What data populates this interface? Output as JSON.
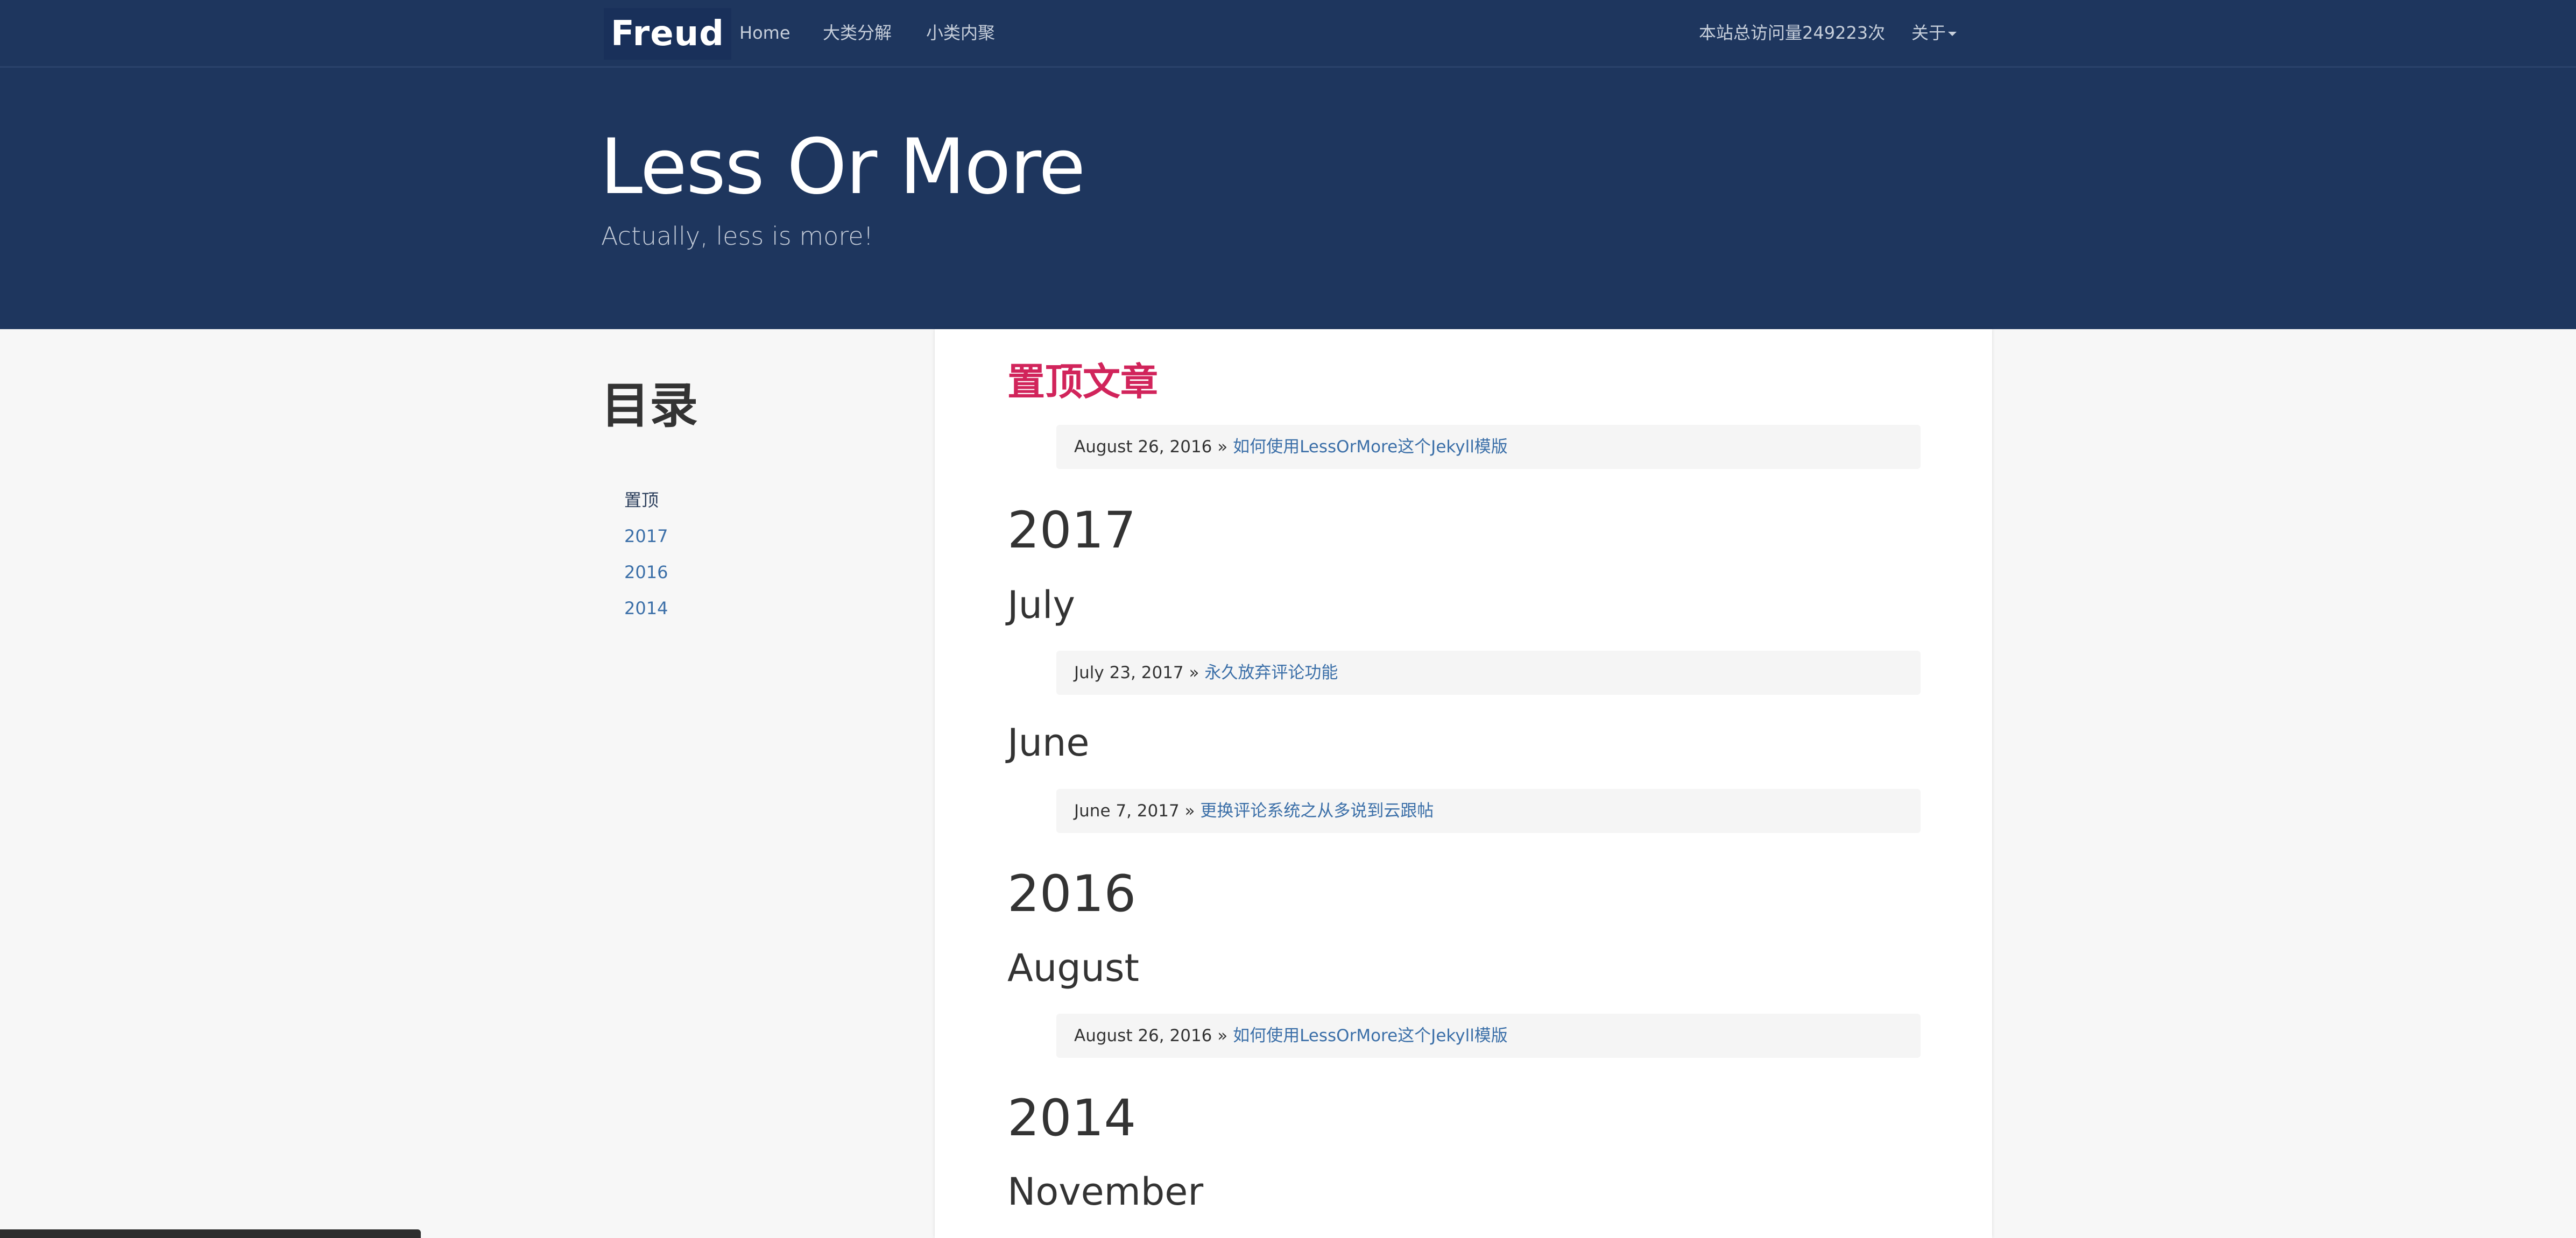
{
  "navbar": {
    "brand": "Freud",
    "links": [
      "Home",
      "大类分解",
      "小类内聚"
    ],
    "visits": "本站总访问量249223次",
    "about": "关于"
  },
  "hero": {
    "title": "Less Or More",
    "subtitle": "Actually, less is more!"
  },
  "toc": {
    "title": "目录",
    "items": [
      "置顶",
      "2017",
      "2016",
      "2014"
    ]
  },
  "main": {
    "pinned": {
      "title": "置顶文章",
      "post": {
        "date": "August 26, 2016 »",
        "title": "如何使用LessOrMore这个Jekyll模版"
      }
    },
    "years": [
      {
        "year": "2017",
        "months": [
          {
            "month": "July",
            "post": {
              "date": "July 23, 2017 »",
              "title": "永久放弃评论功能"
            }
          },
          {
            "month": "June",
            "post": {
              "date": "June 7, 2017 »",
              "title": "更换评论系统之从多说到云跟帖"
            }
          }
        ]
      },
      {
        "year": "2016",
        "months": [
          {
            "month": "August",
            "post": {
              "date": "August 26, 2016 »",
              "title": "如何使用LessOrMore这个Jekyll模版"
            }
          }
        ]
      },
      {
        "year": "2014",
        "months": [
          {
            "month": "November"
          }
        ]
      }
    ]
  },
  "colors": {
    "header_bg": "#1e365e",
    "pinned_title": "#d1245b",
    "link": "#3b6fa8"
  }
}
